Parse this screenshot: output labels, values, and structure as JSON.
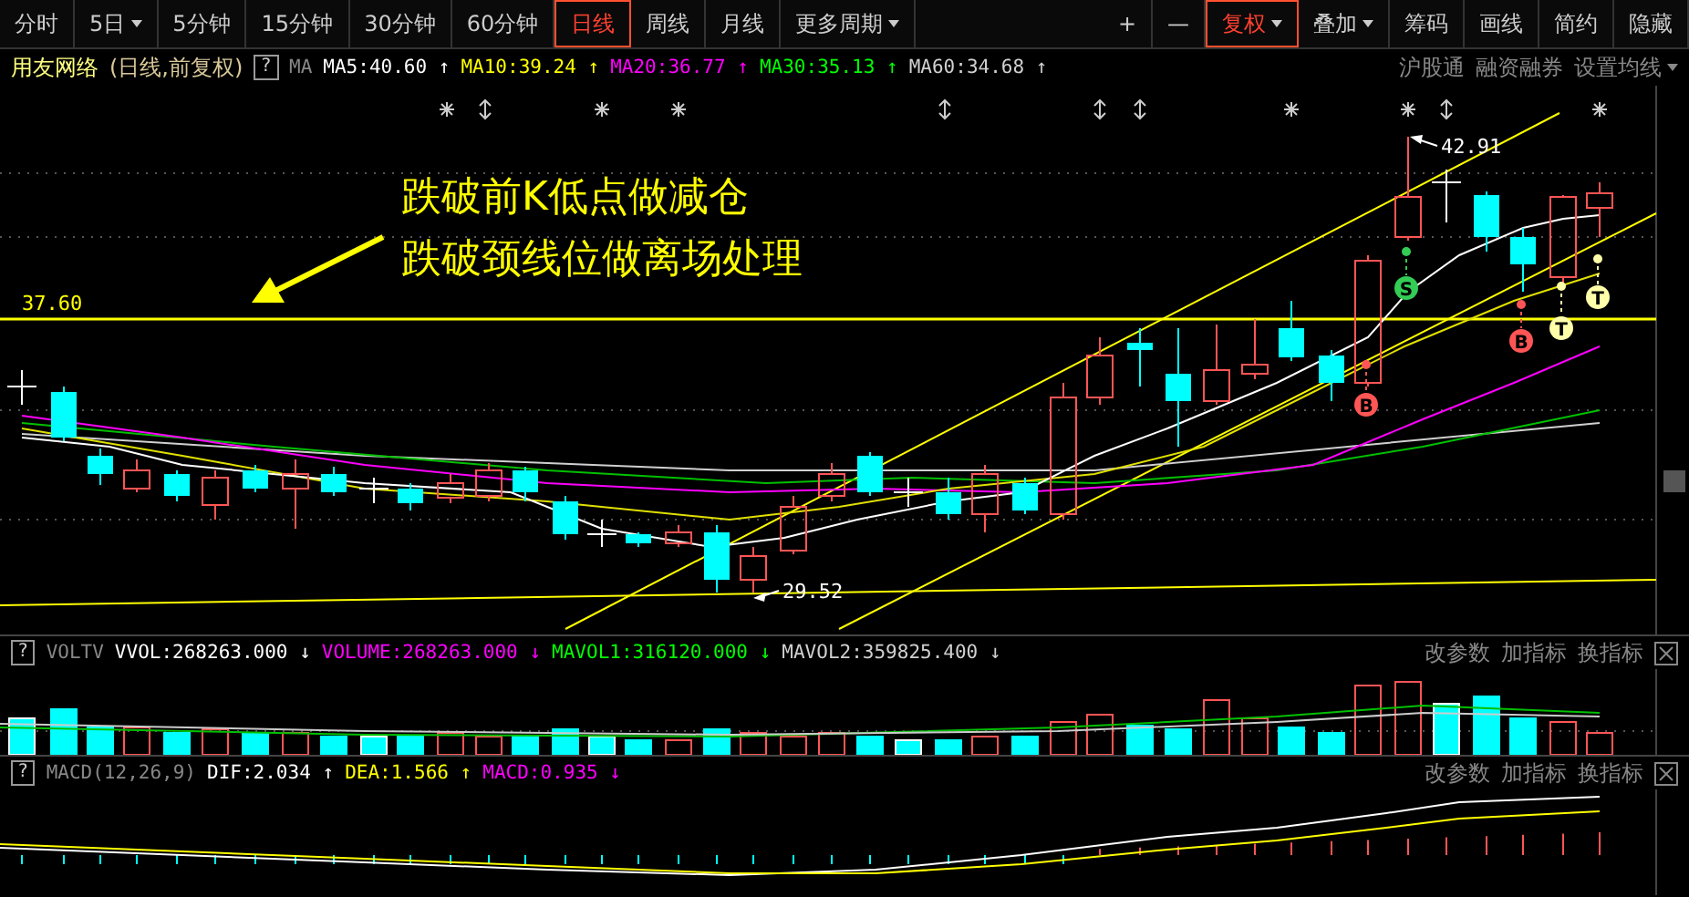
{
  "toolbar": {
    "periods": [
      {
        "label": "分时",
        "selected": false,
        "dropdown": false
      },
      {
        "label": "5日",
        "selected": false,
        "dropdown": true
      },
      {
        "label": "5分钟",
        "selected": false,
        "dropdown": false
      },
      {
        "label": "15分钟",
        "selected": false,
        "dropdown": false
      },
      {
        "label": "30分钟",
        "selected": false,
        "dropdown": false
      },
      {
        "label": "60分钟",
        "selected": false,
        "dropdown": false
      },
      {
        "label": "日线",
        "selected": true,
        "dropdown": false
      },
      {
        "label": "周线",
        "selected": false,
        "dropdown": false
      },
      {
        "label": "月线",
        "selected": false,
        "dropdown": false
      },
      {
        "label": "更多周期",
        "selected": false,
        "dropdown": true
      }
    ],
    "tools": [
      {
        "label": "+",
        "selected": false,
        "dropdown": false
      },
      {
        "label": "—",
        "selected": false,
        "dropdown": false
      },
      {
        "label": "复权",
        "selected": true,
        "dropdown": true
      },
      {
        "label": "叠加",
        "selected": false,
        "dropdown": true
      },
      {
        "label": "筹码",
        "selected": false,
        "dropdown": false
      },
      {
        "label": "画线",
        "selected": false,
        "dropdown": false
      },
      {
        "label": "简约",
        "selected": false,
        "dropdown": false
      },
      {
        "label": "隐藏",
        "selected": false,
        "dropdown": false
      }
    ]
  },
  "instrument": {
    "name": "用友网络",
    "mode": "(日线,前复权)",
    "help": "?",
    "indicator": "MA",
    "values": [
      {
        "label": "MA5:40.60",
        "arrow": "↑",
        "color": "#ffffff"
      },
      {
        "label": "MA10:39.24",
        "arrow": "↑",
        "color": "#ffff00"
      },
      {
        "label": "MA20:36.77",
        "arrow": "↑",
        "color": "#ff00ff"
      },
      {
        "label": "MA30:35.13",
        "arrow": "↑",
        "color": "#00ff00"
      },
      {
        "label": "MA60:34.68",
        "arrow": "↑",
        "color": "#d0d0d0"
      }
    ],
    "links": [
      "沪股通",
      "融资融券"
    ],
    "settings": {
      "label": "设置均线",
      "dropdown": true
    }
  },
  "main_chart": {
    "annotation": [
      "跌破前K低点做减仓",
      "跌破颈线位做离场处理"
    ],
    "level_label": "37.60",
    "high_label": "42.91",
    "low_label": "29.52",
    "signals": [
      {
        "kind": "sell",
        "label": "S"
      },
      {
        "kind": "buy",
        "label": "B"
      },
      {
        "kind": "buy",
        "label": "B"
      },
      {
        "kind": "target",
        "label": "T"
      },
      {
        "kind": "target",
        "label": "T"
      }
    ]
  },
  "volume_panel": {
    "help": "?",
    "name": "VOLTV",
    "values": [
      {
        "label": "VVOL:268263.000",
        "arrow": "↓",
        "color": "#ffffff"
      },
      {
        "label": "VOLUME:268263.000",
        "arrow": "↓",
        "color": "#ff00ff"
      },
      {
        "label": "MAVOL1:316120.000",
        "arrow": "↓",
        "color": "#00ff00"
      },
      {
        "label": "MAVOL2:359825.400",
        "arrow": "↓",
        "color": "#d0d0d0"
      }
    ],
    "actions": [
      "改参数",
      "加指标",
      "换指标"
    ]
  },
  "macd_panel": {
    "help": "?",
    "name": "MACD(12,26,9)",
    "values": [
      {
        "label": "DIF:2.034",
        "arrow": "↑",
        "color": "#ffffff"
      },
      {
        "label": "DEA:1.566",
        "arrow": "↑",
        "color": "#ffff00"
      },
      {
        "label": "MACD:0.935",
        "arrow": "↓",
        "color": "#ff00ff"
      }
    ],
    "actions": [
      "改参数",
      "加指标",
      "换指标"
    ]
  }
}
